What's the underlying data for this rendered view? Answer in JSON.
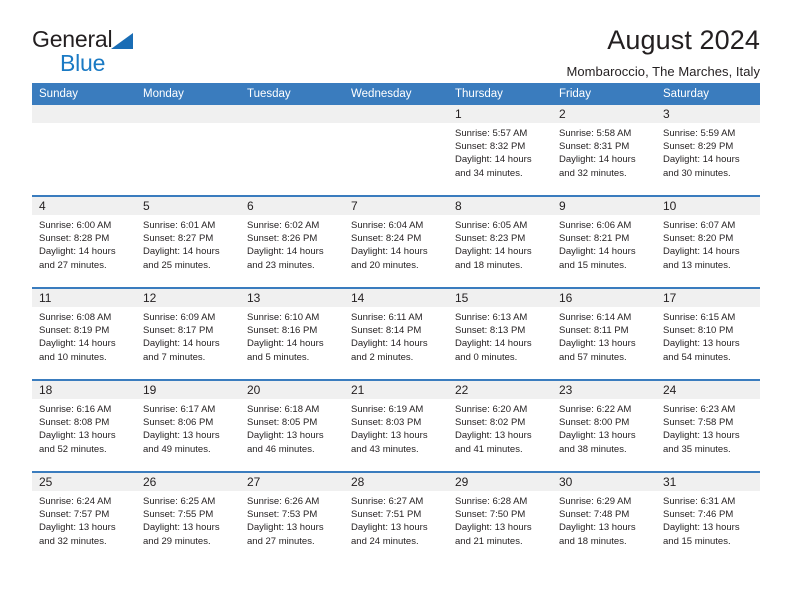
{
  "brand": {
    "name_part1": "General",
    "name_part2": "Blue",
    "triangle_color": "#1a6db5",
    "blue_color": "#1a7ac4"
  },
  "header": {
    "title": "August 2024",
    "subtitle": "Mombaroccio, The Marches, Italy"
  },
  "theme": {
    "header_blue": "#3a7cbe",
    "daynum_band": "#f0f0f0",
    "text": "#231f20"
  },
  "weekdays": [
    "Sunday",
    "Monday",
    "Tuesday",
    "Wednesday",
    "Thursday",
    "Friday",
    "Saturday"
  ],
  "weeks": [
    [
      {
        "day": "",
        "sunrise": "",
        "sunset": "",
        "daylight": ""
      },
      {
        "day": "",
        "sunrise": "",
        "sunset": "",
        "daylight": ""
      },
      {
        "day": "",
        "sunrise": "",
        "sunset": "",
        "daylight": ""
      },
      {
        "day": "",
        "sunrise": "",
        "sunset": "",
        "daylight": ""
      },
      {
        "day": "1",
        "sunrise": "Sunrise: 5:57 AM",
        "sunset": "Sunset: 8:32 PM",
        "daylight": "Daylight: 14 hours and 34 minutes."
      },
      {
        "day": "2",
        "sunrise": "Sunrise: 5:58 AM",
        "sunset": "Sunset: 8:31 PM",
        "daylight": "Daylight: 14 hours and 32 minutes."
      },
      {
        "day": "3",
        "sunrise": "Sunrise: 5:59 AM",
        "sunset": "Sunset: 8:29 PM",
        "daylight": "Daylight: 14 hours and 30 minutes."
      }
    ],
    [
      {
        "day": "4",
        "sunrise": "Sunrise: 6:00 AM",
        "sunset": "Sunset: 8:28 PM",
        "daylight": "Daylight: 14 hours and 27 minutes."
      },
      {
        "day": "5",
        "sunrise": "Sunrise: 6:01 AM",
        "sunset": "Sunset: 8:27 PM",
        "daylight": "Daylight: 14 hours and 25 minutes."
      },
      {
        "day": "6",
        "sunrise": "Sunrise: 6:02 AM",
        "sunset": "Sunset: 8:26 PM",
        "daylight": "Daylight: 14 hours and 23 minutes."
      },
      {
        "day": "7",
        "sunrise": "Sunrise: 6:04 AM",
        "sunset": "Sunset: 8:24 PM",
        "daylight": "Daylight: 14 hours and 20 minutes."
      },
      {
        "day": "8",
        "sunrise": "Sunrise: 6:05 AM",
        "sunset": "Sunset: 8:23 PM",
        "daylight": "Daylight: 14 hours and 18 minutes."
      },
      {
        "day": "9",
        "sunrise": "Sunrise: 6:06 AM",
        "sunset": "Sunset: 8:21 PM",
        "daylight": "Daylight: 14 hours and 15 minutes."
      },
      {
        "day": "10",
        "sunrise": "Sunrise: 6:07 AM",
        "sunset": "Sunset: 8:20 PM",
        "daylight": "Daylight: 14 hours and 13 minutes."
      }
    ],
    [
      {
        "day": "11",
        "sunrise": "Sunrise: 6:08 AM",
        "sunset": "Sunset: 8:19 PM",
        "daylight": "Daylight: 14 hours and 10 minutes."
      },
      {
        "day": "12",
        "sunrise": "Sunrise: 6:09 AM",
        "sunset": "Sunset: 8:17 PM",
        "daylight": "Daylight: 14 hours and 7 minutes."
      },
      {
        "day": "13",
        "sunrise": "Sunrise: 6:10 AM",
        "sunset": "Sunset: 8:16 PM",
        "daylight": "Daylight: 14 hours and 5 minutes."
      },
      {
        "day": "14",
        "sunrise": "Sunrise: 6:11 AM",
        "sunset": "Sunset: 8:14 PM",
        "daylight": "Daylight: 14 hours and 2 minutes."
      },
      {
        "day": "15",
        "sunrise": "Sunrise: 6:13 AM",
        "sunset": "Sunset: 8:13 PM",
        "daylight": "Daylight: 14 hours and 0 minutes."
      },
      {
        "day": "16",
        "sunrise": "Sunrise: 6:14 AM",
        "sunset": "Sunset: 8:11 PM",
        "daylight": "Daylight: 13 hours and 57 minutes."
      },
      {
        "day": "17",
        "sunrise": "Sunrise: 6:15 AM",
        "sunset": "Sunset: 8:10 PM",
        "daylight": "Daylight: 13 hours and 54 minutes."
      }
    ],
    [
      {
        "day": "18",
        "sunrise": "Sunrise: 6:16 AM",
        "sunset": "Sunset: 8:08 PM",
        "daylight": "Daylight: 13 hours and 52 minutes."
      },
      {
        "day": "19",
        "sunrise": "Sunrise: 6:17 AM",
        "sunset": "Sunset: 8:06 PM",
        "daylight": "Daylight: 13 hours and 49 minutes."
      },
      {
        "day": "20",
        "sunrise": "Sunrise: 6:18 AM",
        "sunset": "Sunset: 8:05 PM",
        "daylight": "Daylight: 13 hours and 46 minutes."
      },
      {
        "day": "21",
        "sunrise": "Sunrise: 6:19 AM",
        "sunset": "Sunset: 8:03 PM",
        "daylight": "Daylight: 13 hours and 43 minutes."
      },
      {
        "day": "22",
        "sunrise": "Sunrise: 6:20 AM",
        "sunset": "Sunset: 8:02 PM",
        "daylight": "Daylight: 13 hours and 41 minutes."
      },
      {
        "day": "23",
        "sunrise": "Sunrise: 6:22 AM",
        "sunset": "Sunset: 8:00 PM",
        "daylight": "Daylight: 13 hours and 38 minutes."
      },
      {
        "day": "24",
        "sunrise": "Sunrise: 6:23 AM",
        "sunset": "Sunset: 7:58 PM",
        "daylight": "Daylight: 13 hours and 35 minutes."
      }
    ],
    [
      {
        "day": "25",
        "sunrise": "Sunrise: 6:24 AM",
        "sunset": "Sunset: 7:57 PM",
        "daylight": "Daylight: 13 hours and 32 minutes."
      },
      {
        "day": "26",
        "sunrise": "Sunrise: 6:25 AM",
        "sunset": "Sunset: 7:55 PM",
        "daylight": "Daylight: 13 hours and 29 minutes."
      },
      {
        "day": "27",
        "sunrise": "Sunrise: 6:26 AM",
        "sunset": "Sunset: 7:53 PM",
        "daylight": "Daylight: 13 hours and 27 minutes."
      },
      {
        "day": "28",
        "sunrise": "Sunrise: 6:27 AM",
        "sunset": "Sunset: 7:51 PM",
        "daylight": "Daylight: 13 hours and 24 minutes."
      },
      {
        "day": "29",
        "sunrise": "Sunrise: 6:28 AM",
        "sunset": "Sunset: 7:50 PM",
        "daylight": "Daylight: 13 hours and 21 minutes."
      },
      {
        "day": "30",
        "sunrise": "Sunrise: 6:29 AM",
        "sunset": "Sunset: 7:48 PM",
        "daylight": "Daylight: 13 hours and 18 minutes."
      },
      {
        "day": "31",
        "sunrise": "Sunrise: 6:31 AM",
        "sunset": "Sunset: 7:46 PM",
        "daylight": "Daylight: 13 hours and 15 minutes."
      }
    ]
  ]
}
